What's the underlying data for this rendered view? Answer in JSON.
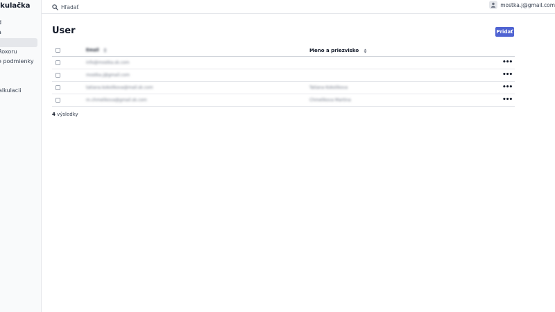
{
  "app": {
    "brand": "alkulačka"
  },
  "sidebar": {
    "items": [
      {
        "label": "d"
      },
      {
        "label": "a"
      },
      {
        "label": ""
      },
      {
        "label": "Roxoru"
      },
      {
        "label": "e podmienky"
      },
      {
        "label": "alkulacii"
      }
    ]
  },
  "topbar": {
    "search_placeholder": "Hľadať",
    "user_email": "mostka.j@gmail.com"
  },
  "page": {
    "title": "User",
    "add_label": "Pridať"
  },
  "table": {
    "columns": {
      "email": "Email",
      "name": "Meno a priezvisko"
    },
    "rows": [
      {
        "email": "info@mostka.sk.com",
        "name": ""
      },
      {
        "email": "mostka.j@gmail.com",
        "name": ""
      },
      {
        "email": "tatiana.kokolikova@mail.sk.com",
        "name": "Tatiana Kokolikova"
      },
      {
        "email": "m.chmelikova@gmail.sk.com",
        "name": "Chmelikova Martina"
      }
    ]
  },
  "results": {
    "count": "4",
    "label": "výsledky"
  }
}
